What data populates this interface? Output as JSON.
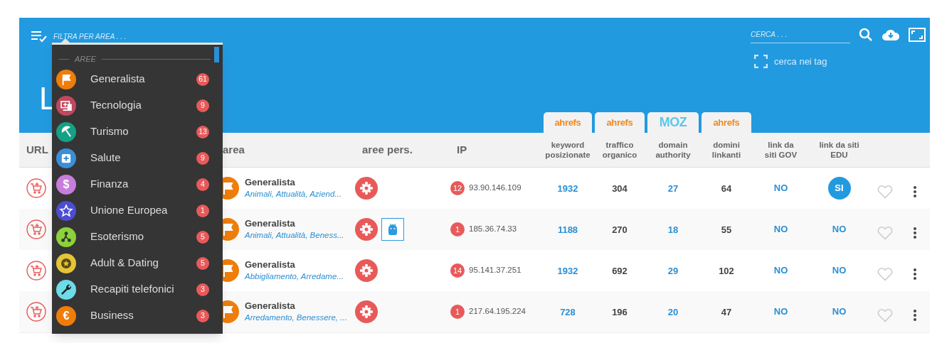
{
  "header": {
    "filter_placeholder": "FILTRA PER AREA . . .",
    "title": "L",
    "search_placeholder": "CERCA . . .",
    "tag_search": {
      "label": "cerca nei tag",
      "checked": false
    },
    "source_tabs": [
      "ahrefs",
      "ahrefs",
      "MOZ",
      "ahrefs"
    ]
  },
  "area_menu": {
    "section": "AREE",
    "items": [
      {
        "label": "Generalista",
        "count": "61",
        "color": "#ef7d0a",
        "kind": "flag"
      },
      {
        "label": "Tecnologia",
        "count": "9",
        "color": "#c0485f",
        "kind": "devices"
      },
      {
        "label": "Turismo",
        "count": "13",
        "color": "#16a085",
        "kind": "umbrella"
      },
      {
        "label": "Salute",
        "count": "9",
        "color": "#3b8fd9",
        "kind": "medical"
      },
      {
        "label": "Finanza",
        "count": "4",
        "color": "#c77ddb",
        "kind": "glyph",
        "glyph": "$"
      },
      {
        "label": "Unione Europea",
        "count": "1",
        "color": "#4c4ed1",
        "kind": "star"
      },
      {
        "label": "Esoterismo",
        "count": "5",
        "color": "#8bd339",
        "kind": "nodes"
      },
      {
        "label": "Adult & Dating",
        "count": "5",
        "color": "#e3c537",
        "kind": "coin"
      },
      {
        "label": "Recapiti telefonici",
        "count": "3",
        "color": "#6ddbe8",
        "kind": "wrench"
      },
      {
        "label": "Business",
        "count": "3",
        "color": "#ef7d0a",
        "kind": "glyph",
        "glyph": "€"
      }
    ]
  },
  "table": {
    "columns": [
      "URL",
      "area",
      "aree pers.",
      "IP",
      "keyword posizionate",
      "traffico organico",
      "domain authority",
      "domini linkanti",
      "link da siti GOV",
      "link da siti EDU"
    ],
    "rows": [
      {
        "area": "Generalista",
        "area_tags": "Animali, Attualità, Aziend...",
        "android": false,
        "ip_count": "12",
        "ip": "93.90.146.109",
        "keywords": "1932",
        "traffic": "304",
        "authority": "27",
        "domains": "64",
        "gov": {
          "text": "NO",
          "badge": false
        },
        "edu": {
          "text": "SI",
          "badge": true
        }
      },
      {
        "area": "Generalista",
        "area_tags": "Animali, Attualità, Beness...",
        "android": true,
        "ip_count": "1",
        "ip": "185.36.74.33",
        "keywords": "1188",
        "traffic": "270",
        "authority": "18",
        "domains": "55",
        "gov": {
          "text": "NO",
          "badge": false
        },
        "edu": {
          "text": "NO",
          "badge": false
        }
      },
      {
        "area": "Generalista",
        "area_tags": "Abbigliamento, Arredame...",
        "android": false,
        "ip_count": "14",
        "ip": "95.141.37.251",
        "keywords": "1932",
        "traffic": "692",
        "authority": "29",
        "domains": "102",
        "gov": {
          "text": "NO",
          "badge": false
        },
        "edu": {
          "text": "NO",
          "badge": false
        }
      },
      {
        "area": "Generalista",
        "area_tags": "Arredamento, Benessere, ...",
        "android": false,
        "ip_count": "1",
        "ip": "217.64.195.224",
        "keywords": "728",
        "traffic": "196",
        "authority": "20",
        "domains": "47",
        "gov": {
          "text": "NO",
          "badge": false
        },
        "edu": {
          "text": "NO",
          "badge": false
        }
      }
    ]
  }
}
